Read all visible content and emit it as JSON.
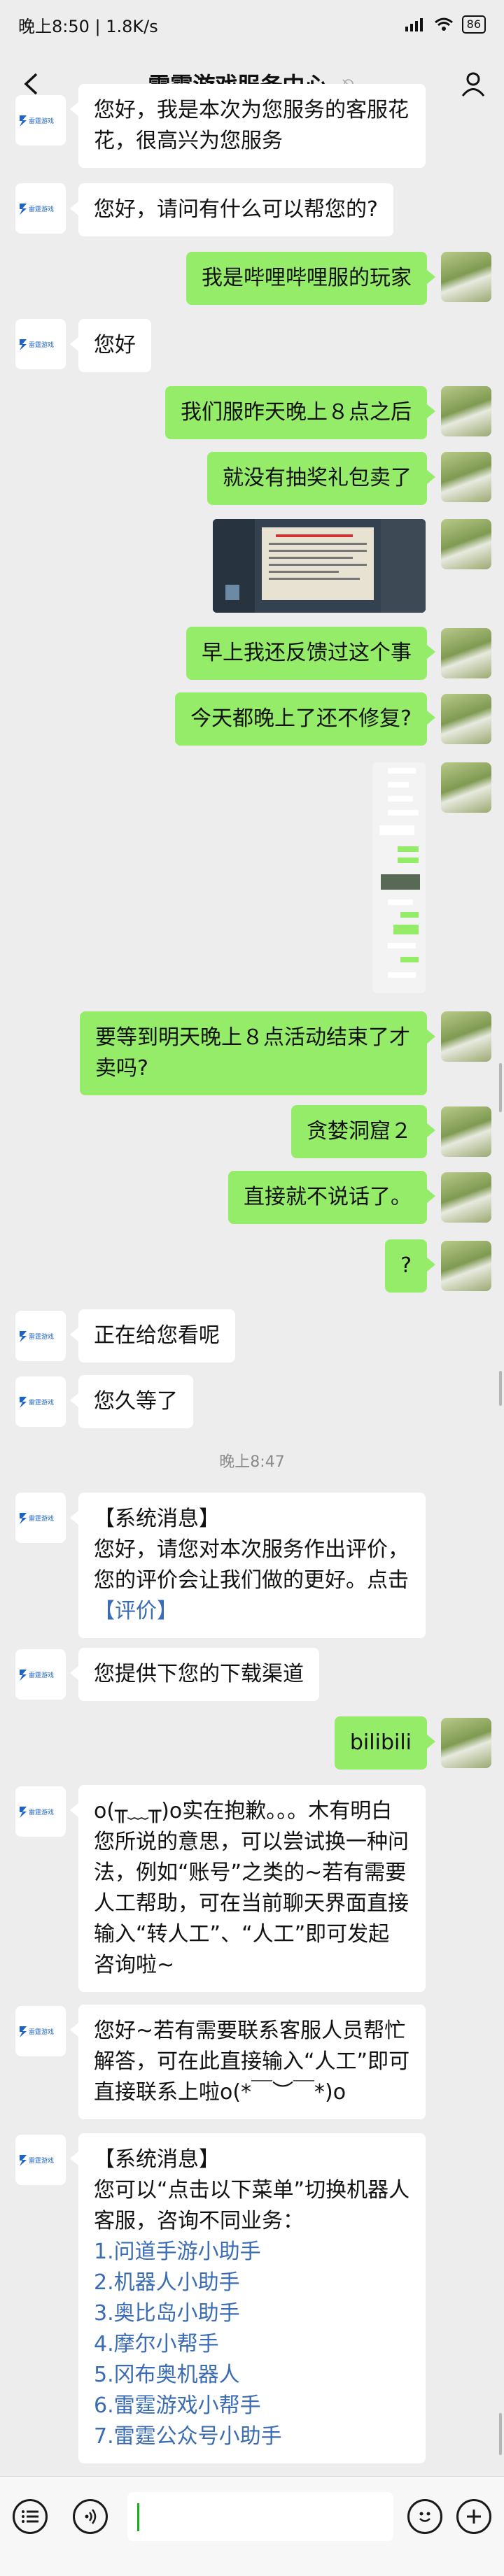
{
  "status_bar": {
    "time_speed": "晚上8:50 | 1.8K/s",
    "battery": "86"
  },
  "header": {
    "title": "雷霆游戏服务中心"
  },
  "brand": {
    "logo_text": "雷霆游戏",
    "accent": "#1e63c8",
    "bubble_right": "#95ec69"
  },
  "messages": [
    {
      "from": "service",
      "text": "您好，我是本次为您服务的客服花花，很高兴为您服务"
    },
    {
      "from": "service",
      "text": "您好，请问有什么可以帮您的?"
    },
    {
      "from": "user",
      "text": "我是哔哩哔哩服的玩家"
    },
    {
      "from": "service",
      "text": "您好"
    },
    {
      "from": "user",
      "text": "我们服昨天晚上８点之后"
    },
    {
      "from": "user",
      "text": "就没有抽奖礼包卖了"
    },
    {
      "from": "user",
      "type": "image",
      "desc": "game-screenshot"
    },
    {
      "from": "user",
      "text": "早上我还反馈过这个事"
    },
    {
      "from": "user",
      "text": "今天都晚上了还不修复?"
    },
    {
      "from": "user",
      "type": "image",
      "desc": "chat-screenshot"
    },
    {
      "from": "user",
      "text": "要等到明天晚上８点活动结束了才卖吗?"
    },
    {
      "from": "user",
      "text": "贪婪洞窟２"
    },
    {
      "from": "user",
      "text": "直接就不说话了。"
    },
    {
      "from": "user",
      "text": "?"
    },
    {
      "from": "service",
      "text": "正在给您看呢"
    },
    {
      "from": "service",
      "text": "您久等了"
    },
    {
      "type": "time",
      "text": "晚上8:47"
    },
    {
      "from": "service",
      "header": "【系统消息】",
      "text": "您好，请您对本次服务作出评价，您的评价会让我们做的更好。点击",
      "link": "【评价】"
    },
    {
      "from": "service",
      "text": "您提供下您的下载渠道"
    },
    {
      "from": "user",
      "text": "bilibili"
    },
    {
      "from": "service",
      "text": "o(╥﹏╥)o实在抱歉。。。木有明白您所说的意思，可以尝试换一种问法，例如“账号”之类的~若有需要人工帮助，可在当前聊天界面直接输入“转人工”、“人工”即可发起咨询啦~"
    },
    {
      "from": "service",
      "text": "您好~若有需要联系客服人员帮忙解答，可在此直接输入“人工”即可直接联系上啦o(*￣︶￣*)o"
    },
    {
      "from": "service",
      "header": "【系统消息】",
      "text": "您可以“点击以下菜单”切换机器人客服，咨询不同业务：",
      "menu": [
        "1.问道手游小助手",
        "2.机器人小助手",
        "3.奥比岛小助手",
        "4.摩尔小帮手",
        "5.冈布奥机器人",
        "6.雷霆游戏小帮手",
        "7.雷霆公众号小助手"
      ]
    }
  ]
}
